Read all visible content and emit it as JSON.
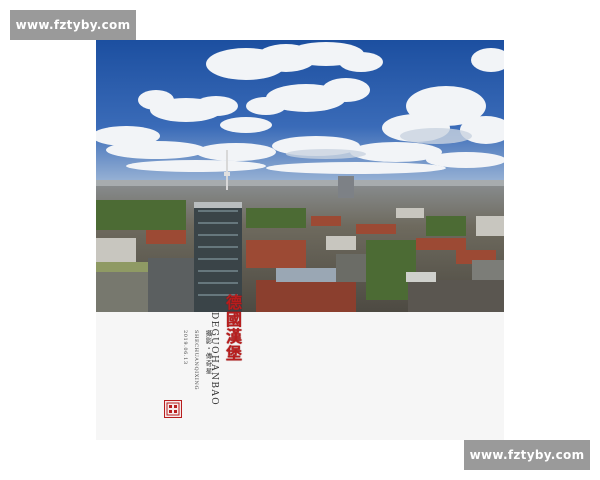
{
  "watermarks": {
    "top": "www.fztyby.com",
    "bottom": "www.fztyby.com"
  },
  "cover": {
    "title_cn": "德國漢堡",
    "title_pinyin": "DEGUOHANBAO",
    "credit_cn": "攝影・傳奇星",
    "credit_en": "SHECHUANQIXING",
    "date": "2019.06.13"
  },
  "colors": {
    "sky": "#2a5aa8",
    "accent_red": "#b81d1d",
    "panel": "#f6f6f6"
  },
  "icons": {
    "seal": "red-seal-stamp"
  }
}
